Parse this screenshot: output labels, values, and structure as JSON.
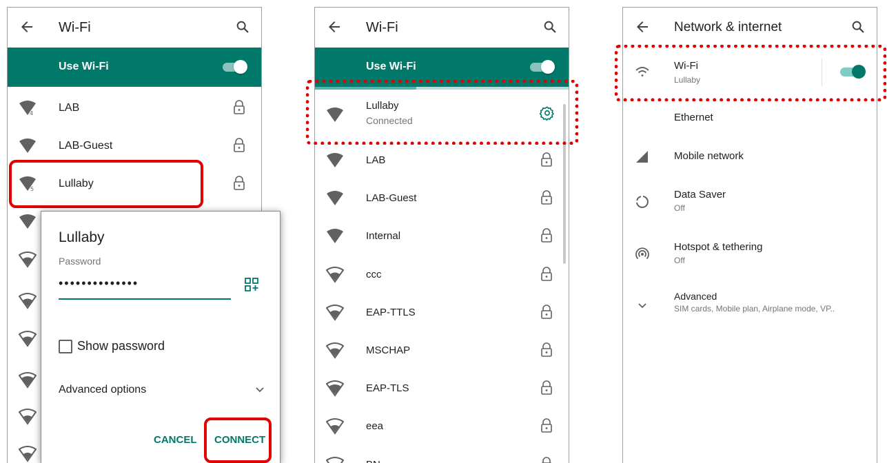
{
  "colors": {
    "accent": "#00796b",
    "highlight": "#e00000"
  },
  "panel1": {
    "title": "Wi-Fi",
    "use_wifi_label": "Use Wi-Fi",
    "networks": [
      {
        "name": "LAB",
        "icon": "wifi-signal-4-icon",
        "locked": true
      },
      {
        "name": "LAB-Guest",
        "icon": "wifi-signal-4-icon",
        "locked": true
      },
      {
        "name": "Lullaby",
        "icon": "wifi-signal-5-icon",
        "locked": true
      }
    ],
    "dialog": {
      "title": "Lullaby",
      "password_label": "Password",
      "password_value": "••••••••••••••",
      "show_password_label": "Show password",
      "advanced_options_label": "Advanced options",
      "cancel_label": "CANCEL",
      "connect_label": "CONNECT"
    }
  },
  "panel2": {
    "title": "Wi-Fi",
    "use_wifi_label": "Use Wi-Fi",
    "connected": {
      "name": "Lullaby",
      "status": "Connected"
    },
    "networks": [
      {
        "name": "LAB",
        "icon": "wifi-signal-4-icon"
      },
      {
        "name": "LAB-Guest",
        "icon": "wifi-signal-4-icon"
      },
      {
        "name": "Internal",
        "icon": "wifi-signal-4-icon"
      },
      {
        "name": "ccc",
        "icon": "wifi-signal-3-icon"
      },
      {
        "name": "EAP-TTLS",
        "icon": "wifi-signal-3-icon"
      },
      {
        "name": "MSCHAP",
        "icon": "wifi-signal-3-icon"
      },
      {
        "name": "EAP-TLS",
        "icon": "wifi-signal-3-icon"
      },
      {
        "name": "eea",
        "icon": "wifi-signal-2-icon"
      },
      {
        "name": "BN",
        "icon": "wifi-signal-2-icon"
      }
    ]
  },
  "panel3": {
    "title": "Network & internet",
    "items": [
      {
        "title": "Wi-Fi",
        "subtitle": "Lullaby"
      },
      {
        "title": "Ethernet",
        "subtitle": ""
      },
      {
        "title": "Mobile network",
        "subtitle": ""
      },
      {
        "title": "Data Saver",
        "subtitle": "Off"
      },
      {
        "title": "Hotspot & tethering",
        "subtitle": "Off"
      },
      {
        "title": "Advanced",
        "subtitle": "SIM cards, Mobile plan, Airplane mode, VP.."
      }
    ]
  }
}
